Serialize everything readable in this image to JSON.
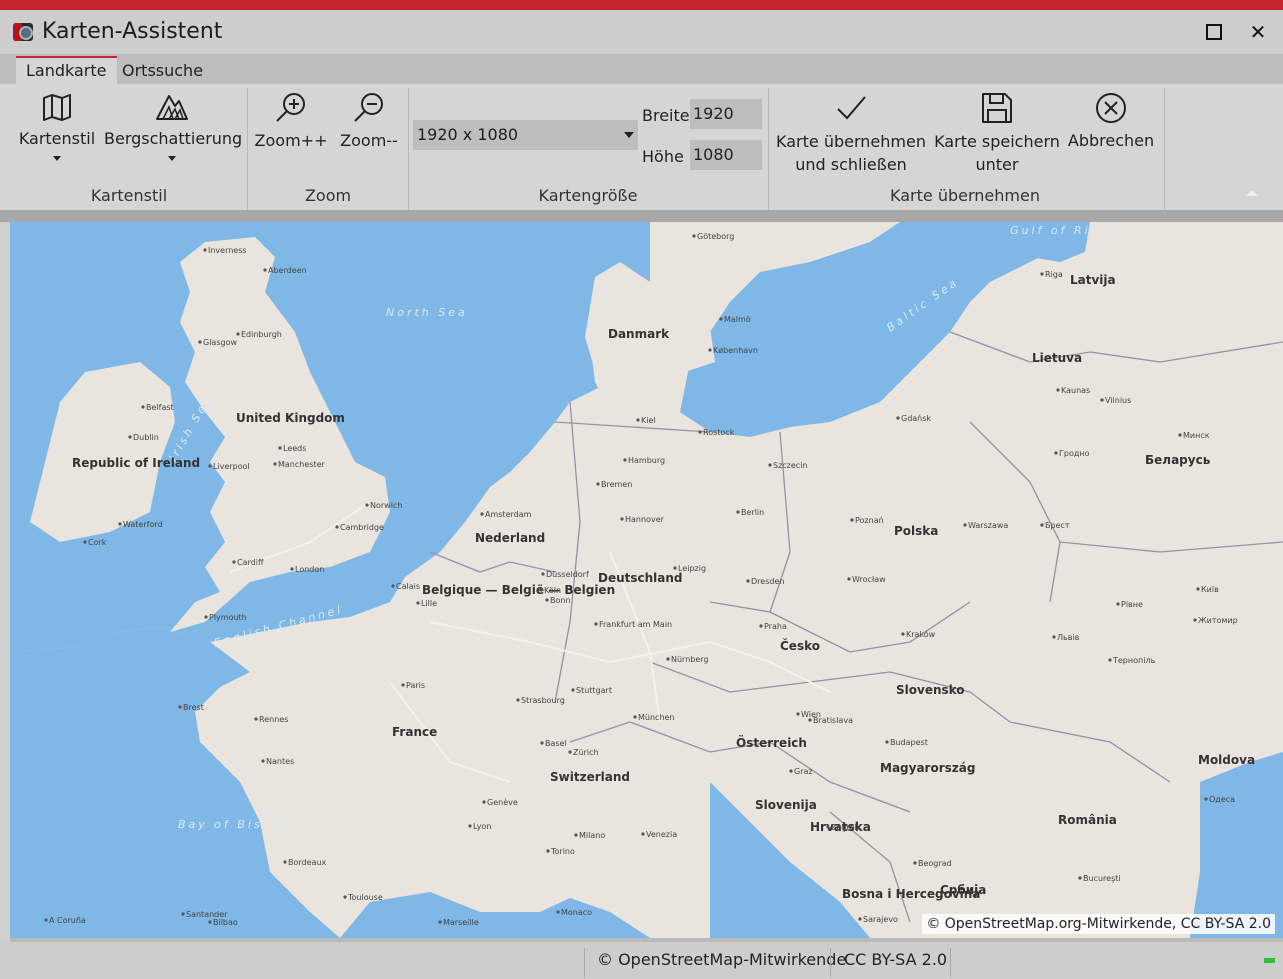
{
  "window": {
    "title": "Karten-Assistent",
    "accent": "#c4262e"
  },
  "tabs": [
    {
      "label": "Landkarte",
      "active": true
    },
    {
      "label": "Ortssuche",
      "active": false
    }
  ],
  "ribbon": {
    "groups": [
      {
        "label": "Kartenstil",
        "buttons": [
          {
            "label": "Kartenstil",
            "icon": "map-icon"
          },
          {
            "label": "Bergschattierung",
            "icon": "mountain-icon"
          }
        ]
      },
      {
        "label": "Zoom",
        "buttons": [
          {
            "label": "Zoom++",
            "icon": "zoom-in-icon"
          },
          {
            "label": "Zoom--",
            "icon": "zoom-out-icon"
          }
        ]
      },
      {
        "label": "Kartengröße"
      },
      {
        "label": "Karte übernehmen",
        "buttons": [
          {
            "label_line1": "Karte übernehmen",
            "label_line2": "und schließen",
            "icon": "check-icon"
          },
          {
            "label_line1": "Karte speichern",
            "label_line2": "unter",
            "icon": "save-icon"
          },
          {
            "label": "Abbrechen",
            "icon": "cancel-icon"
          }
        ]
      }
    ],
    "size": {
      "selected": "1920 x 1080",
      "width_label": "Breite",
      "width_value": "1920",
      "height_label": "Höhe",
      "height_value": "1080"
    }
  },
  "map": {
    "attribution": "© OpenStreetMap.org-Mitwirkende, CC BY-SA 2.0",
    "seas": [
      "North Sea",
      "Baltic Sea",
      "Bay of Biscay",
      "English Channel",
      "Irish Sea",
      "Gulf of Riga"
    ],
    "countries": [
      "Danmark",
      "Latvija",
      "Lietuva",
      "United Kingdom",
      "Republic of Ireland",
      "Беларусь",
      "Polska",
      "Deutschland",
      "Nederland",
      "Belgique — België — Belgien",
      "France",
      "Česko",
      "Slovensko",
      "Österreich",
      "Magyarország",
      "Switzerland",
      "Slovenija",
      "Hrvatska",
      "România",
      "Србија",
      "Moldova",
      "Bosna i Hercegovina"
    ],
    "cities": [
      "Inverness",
      "Aberdeen",
      "Edinburgh",
      "Glasgow",
      "Belfast",
      "Dublin",
      "Leeds",
      "Manchester",
      "Liverpool",
      "Cardiff",
      "London",
      "Norwich",
      "Cambridge",
      "Plymouth",
      "Cork",
      "Waterford",
      "Amsterdam",
      "Hamburg",
      "Berlin",
      "Bremen",
      "Hannover",
      "Kiel",
      "Rostock",
      "Göteborg",
      "Malmö",
      "København",
      "Gdańsk",
      "Szczecin",
      "Poznań",
      "Warszawa",
      "Wrocław",
      "Kraków",
      "Praha",
      "Dresden",
      "Leipzig",
      "Köln",
      "Düsseldorf",
      "Bonn",
      "Frankfurt am Main",
      "Nürnberg",
      "München",
      "Stuttgart",
      "Strasbourg",
      "Paris",
      "Lille",
      "Calais",
      "Brest",
      "Rennes",
      "Nantes",
      "Lyon",
      "Genève",
      "Zürich",
      "Basel",
      "Milano",
      "Torino",
      "Venezia",
      "Wien",
      "Budapest",
      "Bratislava",
      "Graz",
      "Zagreb",
      "Beograd",
      "Bucureşti",
      "Kaunas",
      "Vilnius",
      "Riga",
      "Минск",
      "Гродно",
      "Брест",
      "Львів",
      "Київ",
      "Житомир",
      "Рівне",
      "Тернопіль",
      "Одеса",
      "Bordeaux",
      "Toulouse",
      "Marseille",
      "Monaco",
      "Sarajevo",
      "Bilbao",
      "Santander",
      "A Coruña"
    ]
  },
  "status": {
    "copyright": "© OpenStreetMap-Mitwirkende",
    "license": "CC BY-SA 2.0"
  }
}
